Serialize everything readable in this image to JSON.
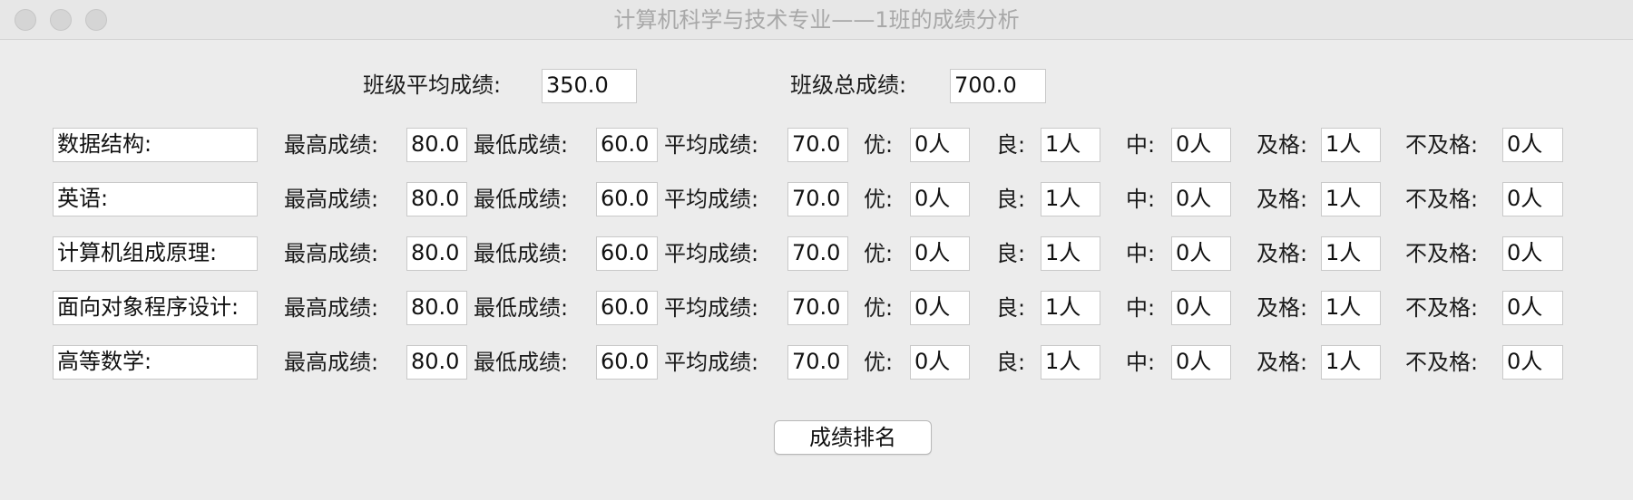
{
  "window": {
    "title": "计算机科学与技术专业——1班的成绩分析"
  },
  "summary": {
    "avg_label": "班级平均成绩:",
    "avg_value": "350.0",
    "total_label": "班级总成绩:",
    "total_value": "700.0"
  },
  "labels": {
    "max": "最高成绩:",
    "min": "最低成绩:",
    "avg": "平均成绩:",
    "excellent": "优:",
    "good": "良:",
    "medium": "中:",
    "pass": "及格:",
    "fail": "不及格:"
  },
  "subjects": [
    {
      "name": "数据结构:",
      "max": "80.0",
      "min": "60.0",
      "avg": "70.0",
      "excellent": "0人",
      "good": "1人",
      "medium": "0人",
      "pass": "1人",
      "fail": "0人"
    },
    {
      "name": "英语:",
      "max": "80.0",
      "min": "60.0",
      "avg": "70.0",
      "excellent": "0人",
      "good": "1人",
      "medium": "0人",
      "pass": "1人",
      "fail": "0人"
    },
    {
      "name": "计算机组成原理:",
      "max": "80.0",
      "min": "60.0",
      "avg": "70.0",
      "excellent": "0人",
      "good": "1人",
      "medium": "0人",
      "pass": "1人",
      "fail": "0人"
    },
    {
      "name": "面向对象程序设计:",
      "max": "80.0",
      "min": "60.0",
      "avg": "70.0",
      "excellent": "0人",
      "good": "1人",
      "medium": "0人",
      "pass": "1人",
      "fail": "0人"
    },
    {
      "name": "高等数学:",
      "max": "80.0",
      "min": "60.0",
      "avg": "70.0",
      "excellent": "0人",
      "good": "1人",
      "medium": "0人",
      "pass": "1人",
      "fail": "0人"
    }
  ],
  "actions": {
    "rank_button": "成绩排名"
  }
}
